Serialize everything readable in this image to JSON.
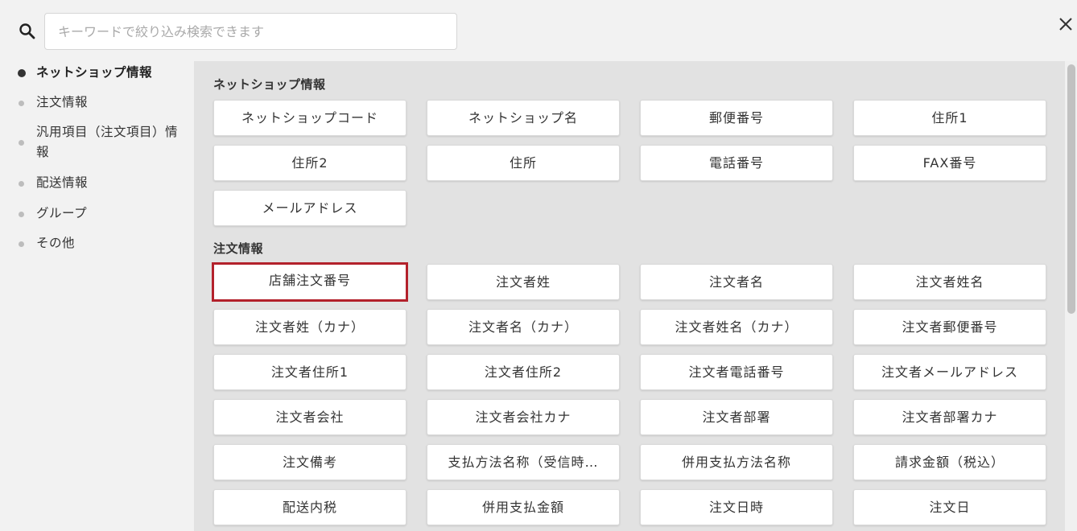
{
  "search": {
    "placeholder": "キーワードで絞り込み検索できます"
  },
  "sidebar": {
    "items": [
      {
        "label": "ネットショップ情報",
        "active": true
      },
      {
        "label": "注文情報",
        "active": false
      },
      {
        "label": "汎用項目（注文項目）情報",
        "active": false
      },
      {
        "label": "配送情報",
        "active": false
      },
      {
        "label": "グループ",
        "active": false
      },
      {
        "label": "その他",
        "active": false
      }
    ]
  },
  "sections": [
    {
      "title": "ネットショップ情報",
      "fields": [
        "ネットショップコード",
        "ネットショップ名",
        "郵便番号",
        "住所1",
        "住所2",
        "住所",
        "電話番号",
        "FAX番号",
        "メールアドレス"
      ]
    },
    {
      "title": "注文情報",
      "fields": [
        "店舗注文番号",
        "注文者姓",
        "注文者名",
        "注文者姓名",
        "注文者姓（カナ）",
        "注文者名（カナ）",
        "注文者姓名（カナ）",
        "注文者郵便番号",
        "注文者住所1",
        "注文者住所2",
        "注文者電話番号",
        "注文者メールアドレス",
        "注文者会社",
        "注文者会社カナ",
        "注文者部署",
        "注文者部署カナ",
        "注文備考",
        "支払方法名称（受信時…",
        "併用支払方法名称",
        "請求金額（税込）",
        "配送内税",
        "併用支払金額",
        "注文日時",
        "注文日"
      ]
    }
  ],
  "selected_field": "店舗注文番号",
  "colors": {
    "selected_border": "#b3212b",
    "panel_bg": "#e2e2e2"
  }
}
